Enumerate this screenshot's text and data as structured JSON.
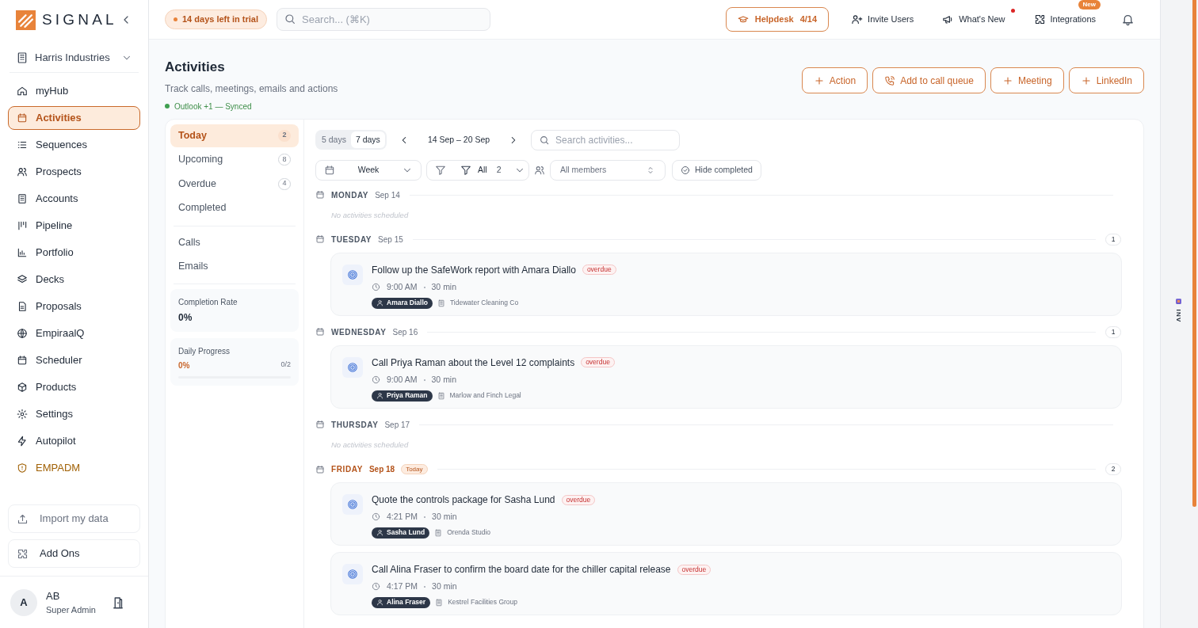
{
  "brand": {
    "name": "SIGNAL"
  },
  "org": {
    "name": "Harris Industries"
  },
  "nav": [
    {
      "label": "myHub",
      "selected": false,
      "kind": "link"
    },
    {
      "label": "Activities",
      "selected": true,
      "kind": "link"
    },
    {
      "label": "Sequences",
      "selected": false,
      "kind": "link"
    },
    {
      "label": "Prospects",
      "selected": false,
      "kind": "link"
    },
    {
      "label": "Accounts",
      "selected": false,
      "kind": "link"
    },
    {
      "label": "Pipeline",
      "selected": false,
      "kind": "link"
    },
    {
      "label": "Portfolio",
      "selected": false,
      "kind": "link"
    },
    {
      "label": "Decks",
      "selected": false,
      "kind": "link"
    },
    {
      "label": "Proposals",
      "selected": false,
      "kind": "link"
    },
    {
      "label": "EmpiraalQ",
      "selected": false,
      "kind": "link"
    },
    {
      "label": "Scheduler",
      "selected": false,
      "kind": "link"
    },
    {
      "label": "Products",
      "selected": false,
      "kind": "link"
    },
    {
      "label": "Settings",
      "selected": false,
      "kind": "link"
    },
    {
      "label": "Autopilot",
      "selected": false,
      "kind": "link"
    },
    {
      "label": "EMPADM",
      "selected": false,
      "kind": "admin"
    }
  ],
  "sidebar_actions": [
    "Import my data",
    "Add Ons"
  ],
  "user": {
    "avatar": "A",
    "name": "AB",
    "role": "Super Admin"
  },
  "topbar": {
    "trial": "14 days left in trial",
    "search_placeholder": "Search... (⌘K)",
    "helpdesk": "Helpdesk",
    "helpdesk_count": "4/14",
    "links": [
      {
        "label": "Invite Users",
        "dot": false
      },
      {
        "label": "What's New",
        "dot": true
      },
      {
        "label": "Integrations",
        "dot": false,
        "badge": "New"
      }
    ]
  },
  "page": {
    "title": "Activities",
    "subtitle": "Track calls, meetings, emails and actions",
    "sync": "Outlook +1 — Synced",
    "actions": [
      "Action",
      "Add to call queue",
      "Meeting",
      "LinkedIn"
    ]
  },
  "filters": [
    {
      "label": "Today",
      "count": "2",
      "selected": true
    },
    {
      "label": "Upcoming",
      "count": "8",
      "selected": false
    },
    {
      "label": "Overdue",
      "count": "4",
      "selected": false
    },
    {
      "label": "Completed",
      "selected": false
    }
  ],
  "types": [
    {
      "label": "Calls",
      "selected": false
    },
    {
      "label": "Emails",
      "selected": false
    }
  ],
  "stats": {
    "completion_label": "Completion Rate",
    "completion": "0%",
    "progress_label": "Daily Progress",
    "progress": "0%",
    "progress_count": "0/2",
    "level": 0
  },
  "toolbar": {
    "views": [
      {
        "label": "5 days",
        "selected": false
      },
      {
        "label": "7 days",
        "selected": true
      }
    ],
    "range": "14 Sep – 20 Sep",
    "search_placeholder": "Search activities...",
    "period": "Week",
    "filter": "All",
    "filter_count": "2",
    "members_placeholder": "All members",
    "hide_completed": "Hide completed"
  },
  "days": [
    {
      "day": "MONDAY",
      "date": "Sep 14",
      "today": false,
      "empty": "No activities scheduled"
    },
    {
      "day": "TUESDAY",
      "date": "Sep 15",
      "today": false,
      "count": "1",
      "activities": [
        {
          "title": "Follow up the SafeWork report with Amara Diallo",
          "status": "overdue",
          "time": "9:00 AM",
          "duration": "30 min",
          "contact": "Amara Diallo",
          "company": "Tidewater Cleaning Co"
        }
      ]
    },
    {
      "day": "WEDNESDAY",
      "date": "Sep 16",
      "today": false,
      "count": "1",
      "activities": [
        {
          "title": "Call Priya Raman about the Level 12 complaints",
          "status": "overdue",
          "time": "9:00 AM",
          "duration": "30 min",
          "contact": "Priya Raman",
          "company": "Marlow and Finch Legal"
        }
      ]
    },
    {
      "day": "THURSDAY",
      "date": "Sep 17",
      "today": false,
      "empty": "No activities scheduled"
    },
    {
      "day": "FRIDAY",
      "date": "Sep 18",
      "today": true,
      "today_label": "Today",
      "count": "2",
      "activities": [
        {
          "title": "Quote the controls package for Sasha Lund",
          "status": "overdue",
          "time": "4:21 PM",
          "duration": "30 min",
          "contact": "Sasha Lund",
          "company": "Orenda Studio"
        },
        {
          "title": "Call Alina Fraser to confirm the board date for the chiller capital release",
          "status": "overdue",
          "time": "4:17 PM",
          "duration": "30 min",
          "contact": "Alina Fraser",
          "company": "Kestrel Facilities Group"
        }
      ]
    }
  ],
  "side_tab": {
    "label": "INV"
  }
}
